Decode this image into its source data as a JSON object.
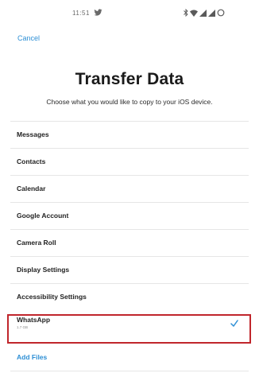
{
  "status_bar": {
    "time": "11:51",
    "left_icon": "twitter-icon",
    "right_icons": [
      "bluetooth-icon",
      "wifi-icon",
      "signal-icon",
      "signal-icon",
      "battery-charging-icon"
    ]
  },
  "cancel_label": "Cancel",
  "title": "Transfer Data",
  "subtitle": "Choose what you would like to copy to your iOS device.",
  "items": [
    {
      "label": "Messages"
    },
    {
      "label": "Contacts"
    },
    {
      "label": "Calendar"
    },
    {
      "label": "Google Account"
    },
    {
      "label": "Camera Roll"
    },
    {
      "label": "Display Settings"
    },
    {
      "label": "Accessibility Settings"
    },
    {
      "label": "WhatsApp",
      "sublabel": "1.7 GB",
      "selected": true
    }
  ],
  "add_files_label": "Add Files",
  "colors": {
    "accent": "#2d8fd5",
    "highlight": "#c0262c",
    "divider": "#e6e6e6"
  }
}
